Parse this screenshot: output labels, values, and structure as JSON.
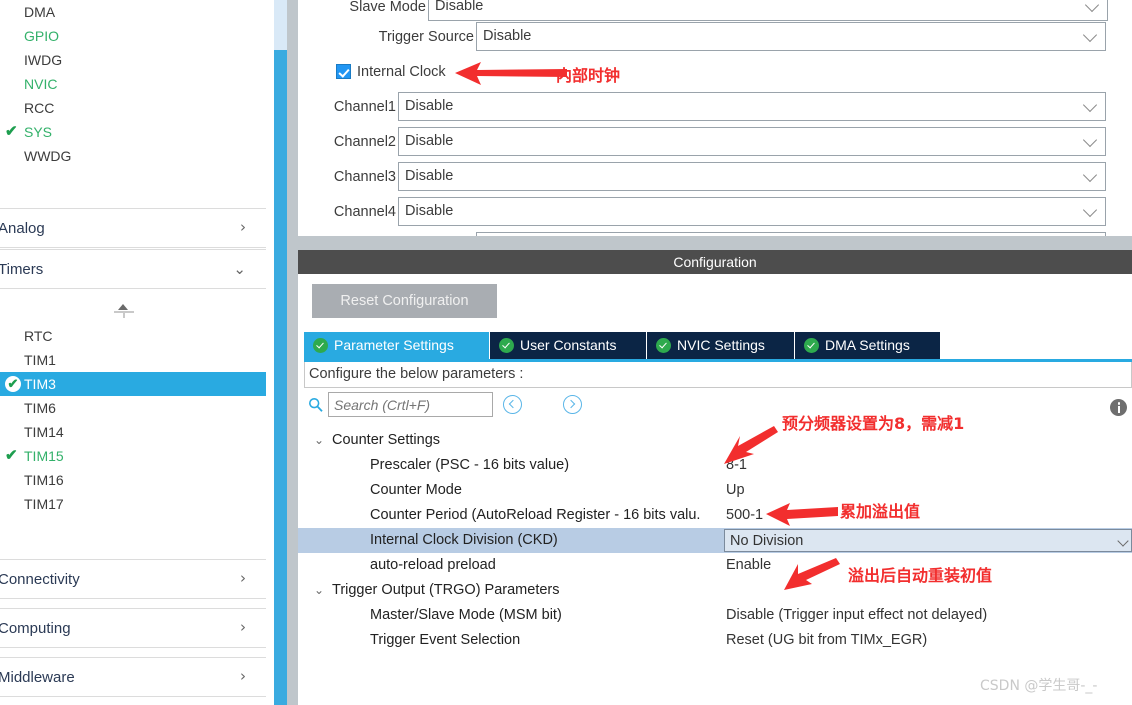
{
  "app": {
    "watermark": "CSDN @学生哥-_-"
  },
  "sidebar": {
    "peripherals": [
      {
        "label": "DMA",
        "state": "none"
      },
      {
        "label": "GPIO",
        "state": "green"
      },
      {
        "label": "IWDG",
        "state": "none"
      },
      {
        "label": "NVIC",
        "state": "green"
      },
      {
        "label": "RCC",
        "state": "none"
      },
      {
        "label": "SYS",
        "state": "green",
        "check": "✔"
      },
      {
        "label": "WWDG",
        "state": "none"
      }
    ],
    "sections": {
      "analog": {
        "label": "Analog",
        "arrow": "›",
        "expanded": false
      },
      "timers": {
        "label": "Timers",
        "arrow": "⌄",
        "expanded": true
      },
      "connectivity": {
        "label": "Connectivity",
        "arrow": "›",
        "expanded": false
      },
      "computing": {
        "label": "Computing",
        "arrow": "›",
        "expanded": false
      },
      "middleware": {
        "label": "Middleware",
        "arrow": "›",
        "expanded": false
      }
    },
    "timers": [
      {
        "label": "RTC",
        "state": "none"
      },
      {
        "label": "TIM1",
        "state": "none"
      },
      {
        "label": "TIM3",
        "state": "selected",
        "check": "✔"
      },
      {
        "label": "TIM6",
        "state": "none"
      },
      {
        "label": "TIM14",
        "state": "none"
      },
      {
        "label": "TIM15",
        "state": "green",
        "check": "✔"
      },
      {
        "label": "TIM16",
        "state": "none"
      },
      {
        "label": "TIM17",
        "state": "none"
      }
    ]
  },
  "mode_panel": {
    "rows": [
      {
        "label": "Slave Mode",
        "value": "Disable"
      },
      {
        "label": "Trigger Source",
        "value": "Disable"
      },
      {
        "label": "Channel1",
        "value": "Disable"
      },
      {
        "label": "Channel2",
        "value": "Disable"
      },
      {
        "label": "Channel3",
        "value": "Disable"
      },
      {
        "label": "Channel4",
        "value": "Disable"
      }
    ],
    "internal_clock": {
      "label": "Internal Clock",
      "checked": true
    }
  },
  "configuration": {
    "title": "Configuration",
    "reset_button": "Reset Configuration",
    "tabs": [
      {
        "label": "Parameter Settings",
        "active": true
      },
      {
        "label": "User Constants",
        "active": false
      },
      {
        "label": "NVIC Settings",
        "active": false
      },
      {
        "label": "DMA Settings",
        "active": false
      }
    ],
    "configure_hint": "Configure the below parameters :",
    "search_placeholder": "Search (Crtl+F)",
    "search_value": ""
  },
  "parameters": [
    {
      "kind": "group",
      "twisty": "⌄",
      "name": "Counter Settings",
      "value": ""
    },
    {
      "kind": "leaf",
      "name": "Prescaler (PSC - 16 bits value)",
      "value": "8-1"
    },
    {
      "kind": "leaf",
      "name": "Counter Mode",
      "value": "Up"
    },
    {
      "kind": "leaf",
      "name": "Counter Period (AutoReload Register - 16 bits valu.",
      "value": "500-1"
    },
    {
      "kind": "leaf",
      "name": "Internal Clock Division (CKD)",
      "value": "No Division",
      "selected": true
    },
    {
      "kind": "leaf",
      "name": "auto-reload preload",
      "value": "Enable"
    },
    {
      "kind": "group",
      "twisty": "⌄",
      "name": "Trigger Output (TRGO) Parameters",
      "value": ""
    },
    {
      "kind": "leaf",
      "name": "Master/Slave Mode (MSM bit)",
      "value": "Disable (Trigger input effect not delayed)"
    },
    {
      "kind": "leaf",
      "name": "Trigger Event Selection",
      "value": "Reset (UG bit from TIMx_EGR)"
    }
  ],
  "annotations": [
    {
      "id": "internal_clock",
      "text": "内部时钟"
    },
    {
      "id": "prescaler",
      "text": "预分频器设置为8，需减1"
    },
    {
      "id": "counter_period",
      "text": "累加溢出值"
    },
    {
      "id": "auto_reload",
      "text": "溢出后自动重装初值"
    }
  ],
  "colors": {
    "accent_blue": "#29aae1",
    "tab_navy": "#0b2545",
    "green_check": "#2eaa4e",
    "annotation_red": "#f22e2e",
    "selected_row": "#b8cce4"
  }
}
